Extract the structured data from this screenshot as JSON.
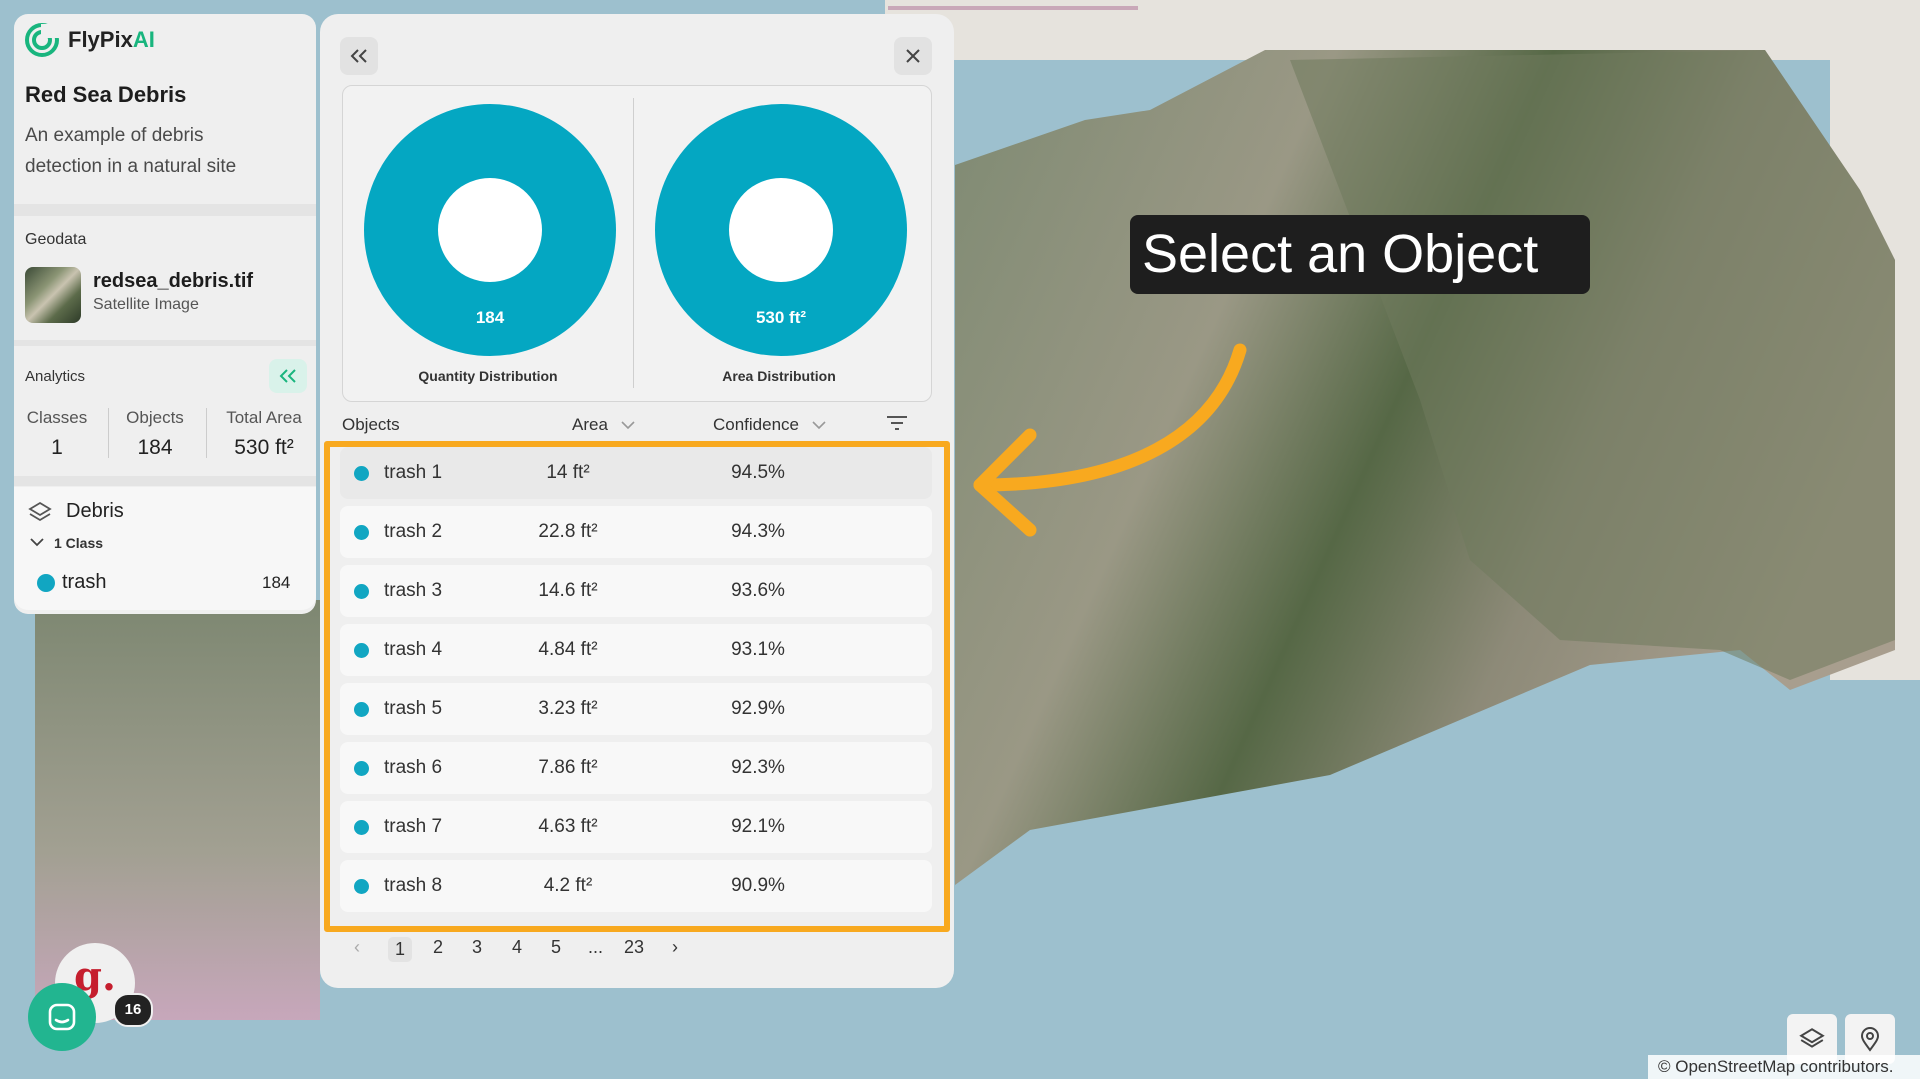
{
  "app": {
    "brand_prefix": "FlyPix",
    "brand_suffix": "AI",
    "project_title": "Red Sea Debris",
    "project_description": "An example of debris detection in a natural site"
  },
  "geodata": {
    "label": "Geodata",
    "file_name": "redsea_debris.tif",
    "file_type": "Satellite Image"
  },
  "analytics": {
    "label": "Analytics",
    "stats": [
      {
        "key": "Classes",
        "value": "1"
      },
      {
        "key": "Objects",
        "value": "184"
      },
      {
        "key": "Total Area",
        "value": "530 ft²"
      }
    ]
  },
  "layer": {
    "name": "Debris",
    "class_count": "1 Class",
    "class_name": "trash",
    "class_total": "184",
    "class_color": "#11a6c2"
  },
  "panel": {
    "charts": [
      {
        "caption": "Quantity Distribution",
        "center_value": "184",
        "color": "#04a7c2"
      },
      {
        "caption": "Area Distribution",
        "center_value": "530 ft²",
        "color": "#04a7c2"
      }
    ],
    "columns": {
      "objects": "Objects",
      "area": "Area",
      "confidence": "Confidence"
    },
    "rows": [
      {
        "name": "trash 1",
        "area": "14 ft²",
        "confidence": "94.5%"
      },
      {
        "name": "trash 2",
        "area": "22.8 ft²",
        "confidence": "94.3%"
      },
      {
        "name": "trash 3",
        "area": "14.6 ft²",
        "confidence": "93.6%"
      },
      {
        "name": "trash 4",
        "area": "4.84 ft²",
        "confidence": "93.1%"
      },
      {
        "name": "trash 5",
        "area": "3.23 ft²",
        "confidence": "92.9%"
      },
      {
        "name": "trash 6",
        "area": "7.86 ft²",
        "confidence": "92.3%"
      },
      {
        "name": "trash 7",
        "area": "4.63 ft²",
        "confidence": "92.1%"
      },
      {
        "name": "trash 8",
        "area": "4.2 ft²",
        "confidence": "90.9%"
      }
    ],
    "pagination": {
      "prev": "‹",
      "pages": [
        "1",
        "2",
        "3",
        "4",
        "5",
        "...",
        "23"
      ],
      "next": "›",
      "current": "1"
    }
  },
  "tooltip": {
    "text": "Select an Object"
  },
  "widgets": {
    "avatar_letter": "g.",
    "badge_count": "16",
    "attribution": "© OpenStreetMap contributors."
  },
  "colors": {
    "accent": "#19b57e",
    "highlight": "#f8a91f",
    "dot": "#11a6c2",
    "chart": "#04a7c2"
  }
}
